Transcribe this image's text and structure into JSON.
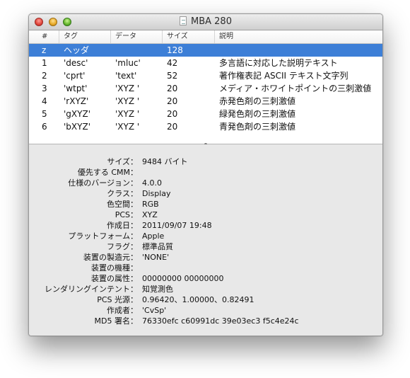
{
  "window": {
    "title": "MBA 280",
    "controls": {
      "close": "close-icon",
      "minimize": "minimize-icon",
      "zoom": "zoom-icon"
    }
  },
  "table": {
    "columns": [
      "#",
      "タグ",
      "データ",
      "サイズ",
      "説明"
    ],
    "rows": [
      [
        "z",
        "ヘッダ",
        "",
        "128",
        ""
      ],
      [
        "1",
        "'desc'",
        "'mluc'",
        "42",
        "多言語に対応した説明テキスト"
      ],
      [
        "2",
        "'cprt'",
        "'text'",
        "52",
        "著作権表記 ASCII テキスト文字列"
      ],
      [
        "3",
        "'wtpt'",
        "'XYZ '",
        "20",
        "メディア・ホワイトポイントの三刺激値"
      ],
      [
        "4",
        "'rXYZ'",
        "'XYZ '",
        "20",
        "赤発色剤の三刺激値"
      ],
      [
        "5",
        "'gXYZ'",
        "'XYZ '",
        "20",
        "緑発色剤の三刺激値"
      ],
      [
        "6",
        "'bXYZ'",
        "'XYZ '",
        "20",
        "青発色剤の三刺激値"
      ]
    ],
    "selected_row": 0
  },
  "details": [
    {
      "label": "サイズ：",
      "value": "9484 バイト"
    },
    {
      "label": "優先する CMM：",
      "value": ""
    },
    {
      "label": "仕様のバージョン：",
      "value": "4.0.0"
    },
    {
      "label": "クラス：",
      "value": "Display"
    },
    {
      "label": "色空間：",
      "value": "RGB"
    },
    {
      "label": "PCS：",
      "value": "XYZ"
    },
    {
      "label": "作成日：",
      "value": "2011/09/07 19:48"
    },
    {
      "label": "プラットフォーム：",
      "value": "Apple"
    },
    {
      "label": "フラグ：",
      "value": "標準品質"
    },
    {
      "label": "装置の製造元：",
      "value": "'NONE'"
    },
    {
      "label": "装置の機種：",
      "value": ""
    },
    {
      "label": "装置の属性：",
      "value": "00000000 00000000"
    },
    {
      "label": "レンダリングインテント：",
      "value": "知覚測色"
    },
    {
      "label": "PCS 光源：",
      "value": "0.96420、1.00000、0.82491"
    },
    {
      "label": "作成者：",
      "value": "'CvSp'"
    },
    {
      "label": "MD5 署名：",
      "value": "76330efc c60991dc 39e03ec3 f5c4e24c"
    }
  ]
}
